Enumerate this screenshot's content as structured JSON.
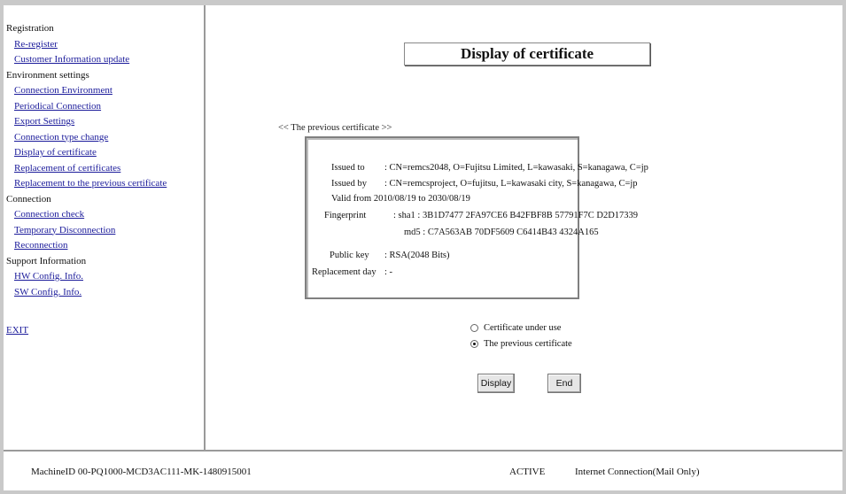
{
  "sidebar": {
    "sections": [
      {
        "title": "Registration",
        "items": [
          "Re-register",
          "Customer Information update"
        ]
      },
      {
        "title": "Environment settings",
        "items": [
          "Connection Environment",
          "Periodical Connection",
          "Export Settings",
          "Connection type change",
          "Display of certificate",
          "Replacement of certificates",
          "Replacement to the previous certificate"
        ]
      },
      {
        "title": "Connection",
        "items": [
          "Connection check",
          "Temporary Disconnection",
          "Reconnection"
        ]
      },
      {
        "title": "Support Information",
        "items": [
          "HW Config. Info.",
          "SW Config. Info."
        ]
      }
    ],
    "exit_label": "EXIT"
  },
  "main": {
    "title": "Display of certificate",
    "prev_nav": "<< The previous certificate >>",
    "certificate": {
      "issued_to_label": "Issued to",
      "issued_to_value": ": CN=remcs2048, O=Fujitsu Limited, L=kawasaki, S=kanagawa, C=jp",
      "issued_by_label": "Issued by",
      "issued_by_value": ": CN=remcsproject, O=fujitsu, L=kawasaki city, S=kanagawa, C=jp",
      "valid_from_line": "Valid from 2010/08/19 to 2030/08/19",
      "fingerprint_label": "Fingerprint",
      "sha1_line": ": sha1 : 3B1D7477 2FA97CE6 B42FBF8B 57791F7C D2D17339",
      "md5_line": "md5 : C7A563AB 70DF5609 C6414B43 4324A165",
      "public_key_label": "Public key",
      "public_key_value": ": RSA(2048 Bits)",
      "replacement_day_label": "Replacement day",
      "replacement_day_value": ": -"
    },
    "options": {
      "under_use_label": "Certificate under use",
      "previous_label": "The previous certificate",
      "selected": "previous"
    },
    "buttons": {
      "display": "Display",
      "end": "End"
    }
  },
  "footer": {
    "machine_id": "MachineID  00-PQ1000-MCD3AC111-MK-1480915001",
    "status": "ACTIVE",
    "connection": "Internet Connection(Mail Only)"
  }
}
